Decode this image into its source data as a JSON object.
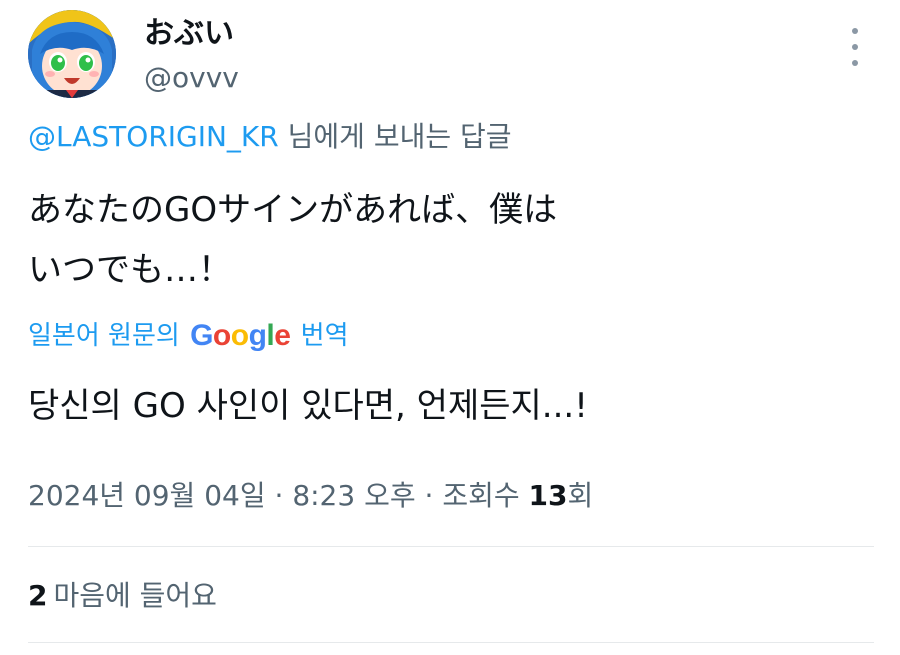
{
  "author": {
    "display_name": "おぶい",
    "handle": "@ovvv"
  },
  "reply_context": {
    "mention": "@LASTORIGIN_KR",
    "suffix": " 님에게 보내는 답글"
  },
  "tweet": {
    "lines": [
      "あなたのGOサインがあれば、僕は",
      "いつでも…！"
    ]
  },
  "translation": {
    "prefix": "일본어 원문의 ",
    "google_letters": [
      {
        "char": "G",
        "color": "#4285F4"
      },
      {
        "char": "o",
        "color": "#EA4335"
      },
      {
        "char": "o",
        "color": "#FBBC05"
      },
      {
        "char": "g",
        "color": "#4285F4"
      },
      {
        "char": "l",
        "color": "#34A853"
      },
      {
        "char": "e",
        "color": "#EA4335"
      }
    ],
    "suffix": " 번역",
    "text": "당신의 GO 사인이 있다면, 언제든지...!"
  },
  "meta": {
    "date": "2024년 09월 04일",
    "separator": " · ",
    "time": "8:23 오후",
    "views_label": "조회수 ",
    "views_count": "13",
    "views_suffix": "회"
  },
  "engagement": {
    "likes_count": "2",
    "likes_label": "마음에 들어요"
  },
  "icons": {
    "more": "more-vertical-icon"
  },
  "colors": {
    "link": "#1d9bf0",
    "secondary_text": "#536471",
    "primary_text": "#0f1419",
    "divider": "#e6e9eb"
  }
}
